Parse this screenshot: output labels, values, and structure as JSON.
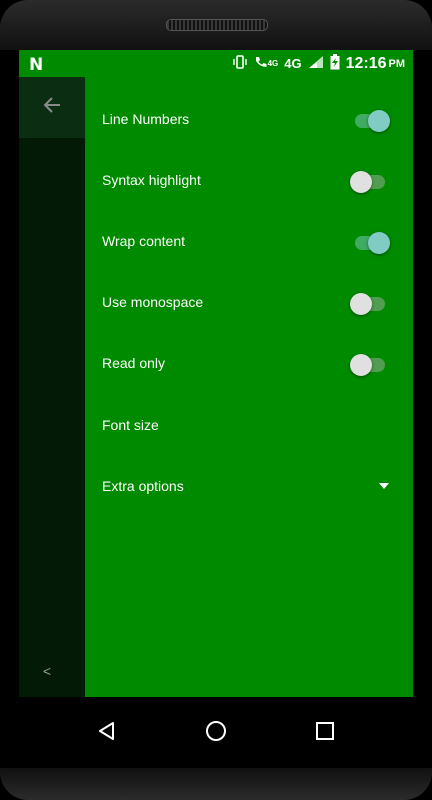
{
  "status_bar": {
    "network_label": "4G",
    "call_network_label": "4G",
    "time": "12:16",
    "ampm": "PM"
  },
  "drawer": {
    "collapse_label": "<"
  },
  "settings": [
    {
      "label": "Line Numbers",
      "type": "switch",
      "checked": true
    },
    {
      "label": "Syntax highlight",
      "type": "switch",
      "checked": false
    },
    {
      "label": "Wrap content",
      "type": "switch",
      "checked": true
    },
    {
      "label": "Use monospace",
      "type": "switch",
      "checked": false
    },
    {
      "label": "Read only",
      "type": "switch",
      "checked": false
    },
    {
      "label": "Font size",
      "type": "item"
    },
    {
      "label": "Extra options",
      "type": "dropdown"
    }
  ],
  "colors": {
    "screen_bg": "#008a00",
    "drawer_bg": "#021a06",
    "switch_on": "#80cbc4",
    "switch_off": "#e0e0e0"
  },
  "icons": {
    "vibrate": "vibrate-icon",
    "call": "call-icon",
    "signal": "signal-icon",
    "battery": "battery-charging-icon",
    "back_arrow": "arrow-back-icon",
    "nav_back": "triangle-back-icon",
    "nav_home": "circle-home-icon",
    "nav_recents": "square-recents-icon"
  }
}
